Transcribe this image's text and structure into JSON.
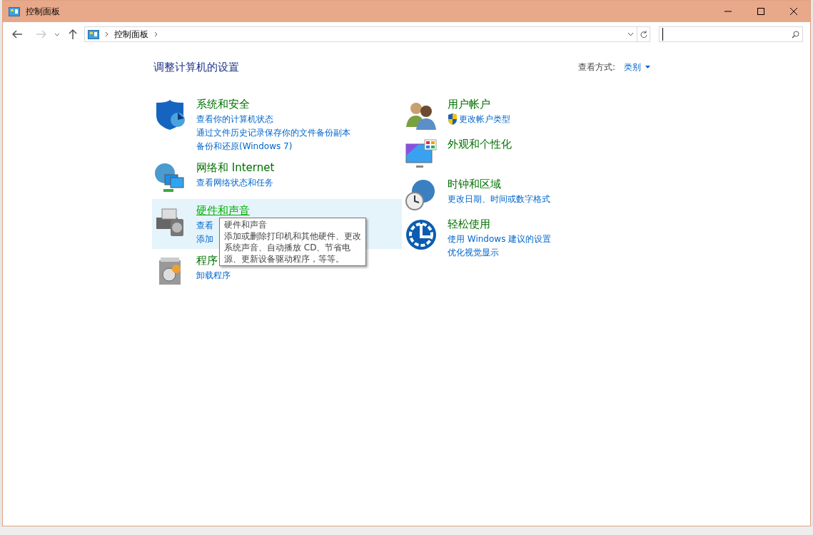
{
  "window": {
    "title": "控制面板"
  },
  "address_bar": {
    "path": [
      "控制面板"
    ]
  },
  "heading": "调整计算机的设置",
  "view_by": {
    "label": "查看方式:",
    "value": "类别"
  },
  "columns": [
    [
      {
        "kind": "shield",
        "title": "系统和安全",
        "hovered": false,
        "links": [
          {
            "text": "查看你的计算机状态",
            "shield": false
          },
          {
            "text": "通过文件历史记录保存你的文件备份副本",
            "shield": false
          },
          {
            "text": "备份和还原(Windows 7)",
            "shield": false
          }
        ]
      },
      {
        "kind": "network",
        "title": "网络和 Internet",
        "hovered": false,
        "links": [
          {
            "text": "查看网络状态和任务",
            "shield": false
          }
        ]
      },
      {
        "kind": "printer",
        "title": "硬件和声音",
        "hovered": true,
        "links": [
          {
            "text": "查看",
            "shield": false
          },
          {
            "text": "添加",
            "shield": false
          }
        ]
      },
      {
        "kind": "programs",
        "title": "程序",
        "hovered": false,
        "links": [
          {
            "text": "卸载程序",
            "shield": false
          }
        ]
      }
    ],
    [
      {
        "kind": "users",
        "title": "用户帐户",
        "hovered": false,
        "links": [
          {
            "text": "更改帐户类型",
            "shield": true
          }
        ]
      },
      {
        "kind": "monitor",
        "title": "外观和个性化",
        "hovered": false
      },
      {
        "kind": "clock",
        "title": "时钟和区域",
        "hovered": false,
        "links": [
          {
            "text": "更改日期、时间或数字格式",
            "shield": false
          }
        ]
      },
      {
        "kind": "ease",
        "title": "轻松使用",
        "hovered": false,
        "links": [
          {
            "text": "使用 Windows 建议的设置",
            "shield": false
          },
          {
            "text": "优化视觉显示",
            "shield": false
          }
        ]
      }
    ]
  ],
  "tooltip": {
    "title": "硬件和声音",
    "text": "添加或删除打印机和其他硬件、更改系统声音、自动播放 CD、节省电源、更新设备驱动程序，等等。"
  }
}
